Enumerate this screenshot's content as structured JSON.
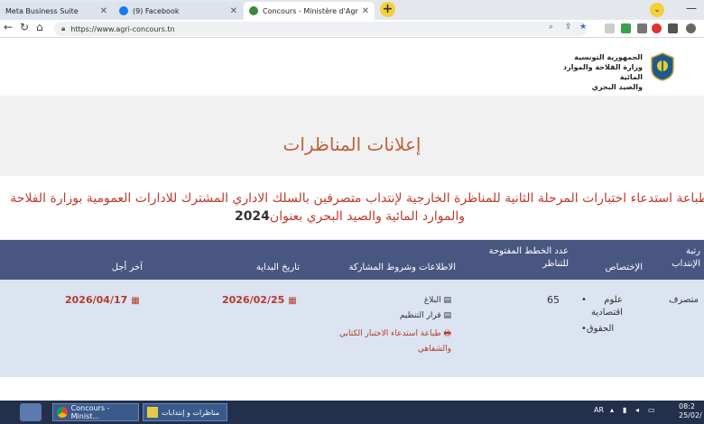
{
  "browser": {
    "tabs": [
      {
        "title": "Meta Business Suite",
        "active": false
      },
      {
        "title": "(9) Facebook",
        "active": false
      },
      {
        "title": "Concours - Ministère d'Agricultu...",
        "active": true
      }
    ],
    "new_tab": "+",
    "url": "https://www.agri-concours.tn"
  },
  "header": {
    "ministry_lines": [
      "الجمهورية التونسية",
      "وزارة الفلاحة والموارد المائية",
      "والصيد البحري"
    ]
  },
  "page": {
    "title": "إعلانات المناظرات",
    "announcement": "طباعة استدعاء اختبارات المرحلة الثانية للمناظرة الخارجية لإنتداب متصرفين بالسلك الاداري المشترك للادارات العمومية بوزارة الفلاحة",
    "announcement_line2": "والموارد المائية والصيد البحري بعنوان",
    "announcement_year": "2024"
  },
  "table": {
    "headers": {
      "rank": "رتبة الإنتداب",
      "specialty": "الإختصاص",
      "positions": "عدد الخطط المفتوحة للتناظر",
      "docs": "الاطلاعات وشروط المشاركة",
      "start": "تاريخ البداية",
      "deadline": "آخر أجل"
    },
    "row": {
      "rank": "متصرف",
      "specialties": [
        "علوم اقتصادية",
        "الحقوق"
      ],
      "positions": "65",
      "docs": [
        {
          "label": "البلاغ",
          "icon": "document-icon"
        },
        {
          "label": "قرار التنظيم",
          "icon": "document-icon"
        },
        {
          "label": "طباعة استدعاء الاختبار الكتابي والشفاهي",
          "icon": "printer-icon"
        }
      ],
      "start": "2026/02/25",
      "deadline": "2026/04/17"
    }
  },
  "taskbar": {
    "items": [
      "Concours - Minist...",
      "مناظرات و إنتدابات"
    ],
    "lang": "AR",
    "time": "08:2",
    "date": "25/02/"
  },
  "colors": {
    "header_bg": "#4a5682",
    "row_bg": "#dbe4f0",
    "accent": "#c0603a",
    "date_red": "#b43a2a"
  }
}
